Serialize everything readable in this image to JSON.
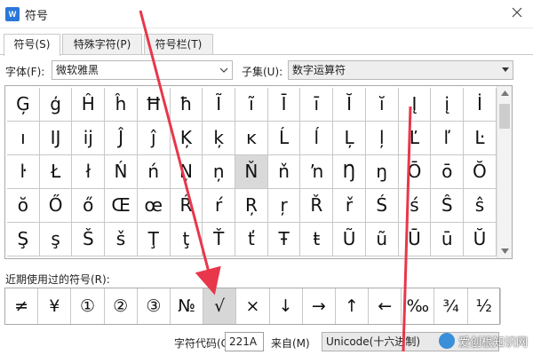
{
  "window": {
    "title": "符号",
    "app_icon_text": "W"
  },
  "tabs": [
    {
      "label": "符号(S)",
      "active": true
    },
    {
      "label": "特殊字符(P)",
      "active": false
    },
    {
      "label": "符号栏(T)",
      "active": false
    }
  ],
  "font": {
    "label": "字体(F):",
    "value": "微软雅黑"
  },
  "subset": {
    "label": "子集(U):",
    "value": "数字运算符"
  },
  "symbol_grid": [
    [
      "Ģ",
      "ģ",
      "Ĥ",
      "ĥ",
      "Ħ",
      "ħ",
      "Ĩ",
      "ĩ",
      "Ī",
      "ī",
      "Ĭ",
      "ĭ",
      "Į",
      "į",
      "İ"
    ],
    [
      "ı",
      "Ĳ",
      "ĳ",
      "Ĵ",
      "ĵ",
      "Ķ",
      "ķ",
      "ĸ",
      "Ĺ",
      "ĺ",
      "Ļ",
      "ļ",
      "Ľ",
      "ľ",
      "Ŀ"
    ],
    [
      "ŀ",
      "Ł",
      "ł",
      "Ń",
      "ń",
      "Ņ",
      "ņ",
      "Ň",
      "ň",
      "ŉ",
      "Ŋ",
      "ŋ",
      "Ō",
      "ō",
      "Ŏ"
    ],
    [
      "ŏ",
      "Ő",
      "ő",
      "Œ",
      "œ",
      "Ŕ",
      "ŕ",
      "Ŗ",
      "ŗ",
      "Ř",
      "ř",
      "Ś",
      "ś",
      "Ŝ",
      "ŝ"
    ],
    [
      "Ş",
      "ş",
      "Š",
      "š",
      "Ţ",
      "ţ",
      "Ť",
      "ť",
      "Ŧ",
      "ŧ",
      "Ũ",
      "ũ",
      "Ū",
      "ū",
      "Ŭ"
    ]
  ],
  "grid_selected": [
    2,
    7
  ],
  "recent": {
    "label": "近期使用过的符号(R):",
    "symbols": [
      "≠",
      "¥",
      "①",
      "②",
      "③",
      "№",
      "√",
      "×",
      "↓",
      "→",
      "↑",
      "←",
      "‰",
      "¾",
      "½"
    ],
    "selected_index": 6
  },
  "char_code": {
    "label": "字符代码(C):",
    "value": "221A"
  },
  "from": {
    "label": "来自(M)",
    "value": "Unicode(十六进制)"
  },
  "watermark": {
    "text": "爱创根知识网"
  },
  "colors": {
    "arrow": "#e8374a",
    "selected_cell": "#d9d9d9",
    "watermark_logo": "#3a8fd9"
  },
  "icons": {
    "close": "close-icon",
    "dropdown": "chevron-down-icon",
    "scroll_up": "triangle-up-icon",
    "scroll_down": "triangle-down-icon"
  }
}
